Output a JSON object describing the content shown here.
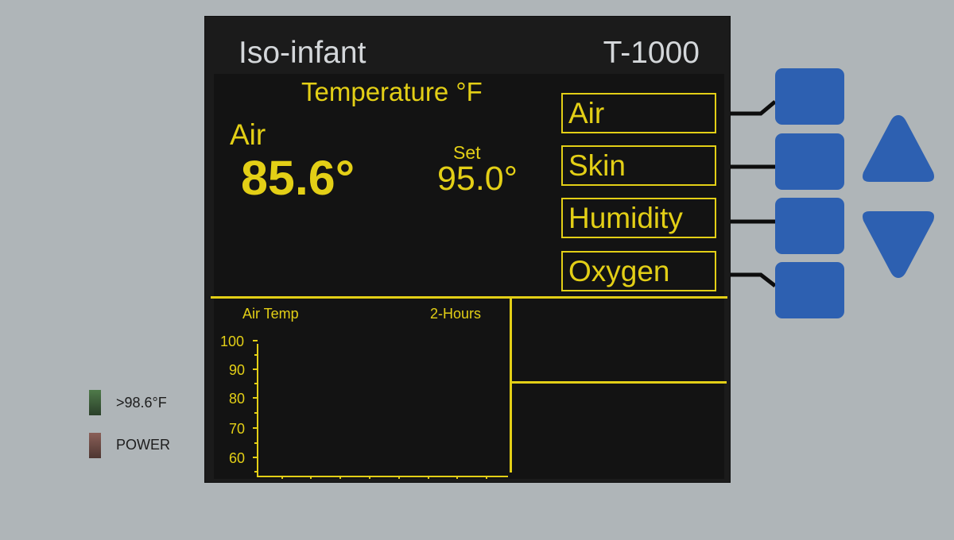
{
  "device": {
    "brand": "Iso-infant",
    "model": "T-1000"
  },
  "display": {
    "title": "Temperature °F",
    "air_label": "Air",
    "air_value": "85.6°",
    "set_label": "Set",
    "set_value": "95.0°",
    "modes": [
      "Air",
      "Skin",
      "Humidity",
      "Oxygen"
    ]
  },
  "graph": {
    "title": "Air Temp",
    "span": "2-Hours",
    "y_ticks": [
      "100",
      "90",
      "80",
      "70",
      "60"
    ]
  },
  "indicators": [
    {
      "label": ">98.6°F",
      "color": "#3c5a3a"
    },
    {
      "label": "POWER",
      "color": "#6a4a45"
    }
  ],
  "colors": {
    "display_text": "#e3cf16",
    "button_blue": "#2d60b1",
    "panel": "#1b1b1b",
    "background": "#afb5b8"
  },
  "icons": [
    "up-arrow-icon",
    "down-arrow-icon"
  ]
}
